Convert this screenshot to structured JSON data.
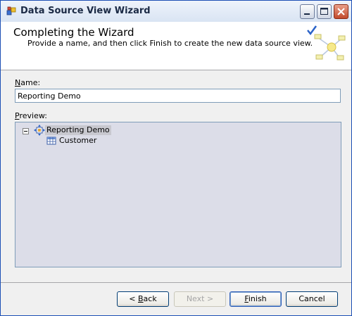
{
  "window": {
    "title": "Data Source View Wizard",
    "buttons": [
      "minimize-icon",
      "maximize-icon",
      "close-icon"
    ]
  },
  "header": {
    "title": "Completing the Wizard",
    "subtitle": "Provide a name, and then click Finish to create the new data source view."
  },
  "form": {
    "name_label_underlined": "N",
    "name_label_rest": "ame:",
    "name_value": "Reporting Demo",
    "preview_label_underlined": "P",
    "preview_label_rest": "review:"
  },
  "tree": {
    "root": {
      "label": "Reporting Demo",
      "icon": "data-source-view-icon",
      "expanded": true
    },
    "children": [
      {
        "label": "Customer",
        "icon": "table-icon"
      }
    ]
  },
  "buttons": {
    "back_prefix": "< ",
    "back_underlined": "B",
    "back_rest": "ack",
    "next_label": "Next >",
    "finish_underlined": "F",
    "finish_rest": "inish",
    "cancel_label": "Cancel"
  },
  "colors": {
    "title_bar": "#dfe7f3",
    "header_bg": "#ffffff",
    "preview_bg": "#dcdde8",
    "selected_node": "#c8c8cf"
  }
}
